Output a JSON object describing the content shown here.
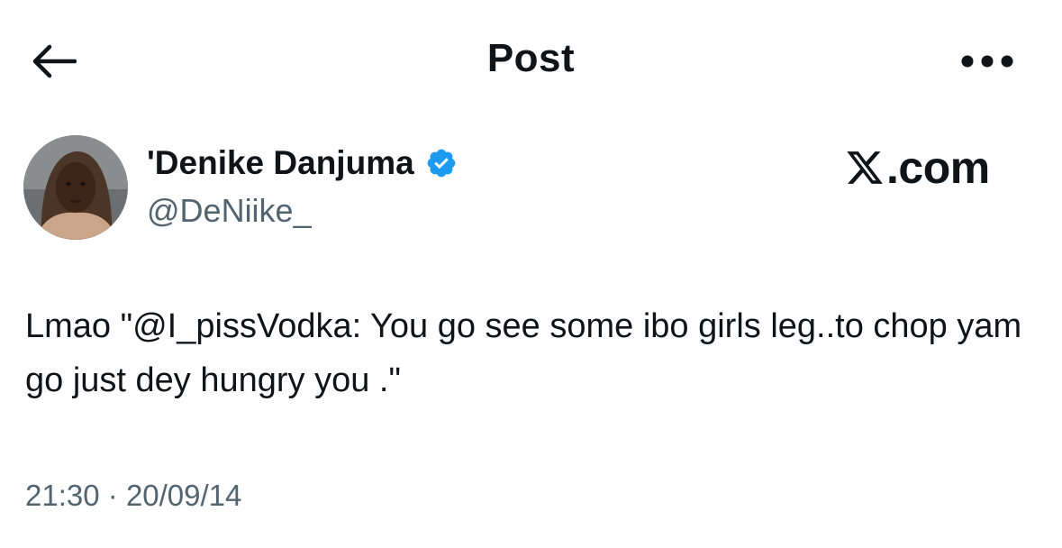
{
  "header": {
    "title": "Post",
    "back_icon": "arrow-left-icon",
    "more_icon": "more-horizontal-icon"
  },
  "author": {
    "display_name": "'Denike Danjuma",
    "handle": "@DeNiike_",
    "verified": true,
    "verified_color": "#1d9bf0"
  },
  "watermark": {
    "logo": "x-logo",
    "text": ".com"
  },
  "post": {
    "text": "Lmao \"@I_pissVodka: You go see some ibo girls leg..to chop yam go just dey hungry you .\"",
    "time": "21:30",
    "separator": "·",
    "date": "20/09/14"
  },
  "colors": {
    "text_primary": "#0f1419",
    "text_secondary": "#536471",
    "background": "#ffffff"
  }
}
